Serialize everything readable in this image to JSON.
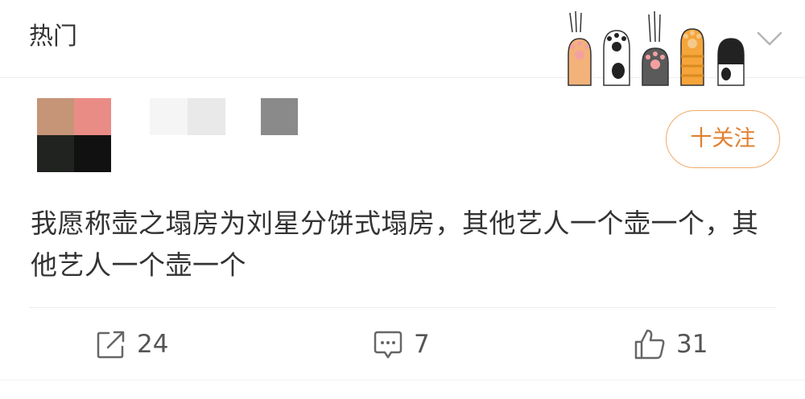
{
  "header": {
    "title": "热门",
    "decoration_icon": "cat-paws-icon",
    "expand_icon": "chevron-down-icon"
  },
  "post": {
    "avatar": {
      "colors": [
        "#c69477",
        "#ea8c86",
        "#202320",
        "#111111"
      ]
    },
    "follow_label": "十关注",
    "text": "我愿称壶之塌房为刘星分饼式塌房，其他艺人一个壶一个，其他艺人一个壶一个"
  },
  "actions": {
    "repost_count": "24",
    "comment_count": "7",
    "like_count": "31"
  },
  "colors": {
    "accent": "#e27f2e",
    "accent_border": "#f2a96a",
    "text": "#333333",
    "muted": "#555555",
    "divider": "#ededed"
  }
}
